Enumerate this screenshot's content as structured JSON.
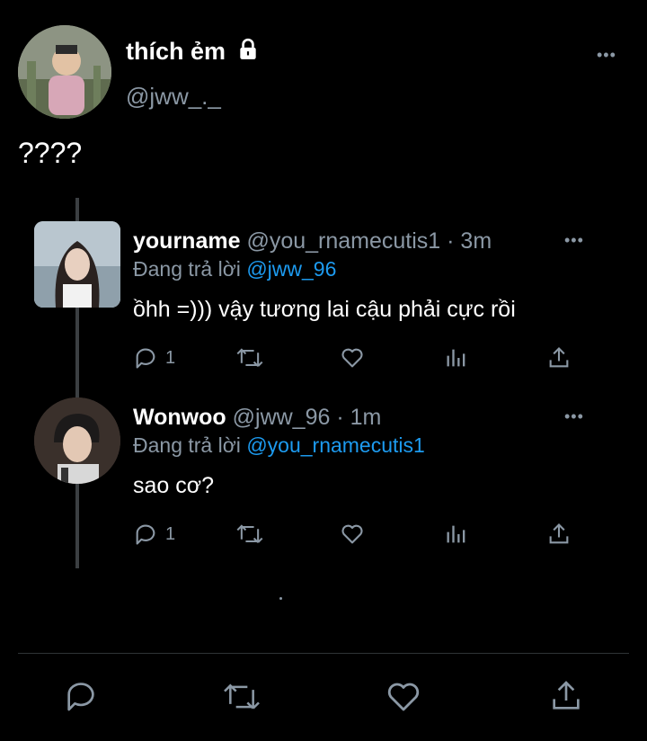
{
  "main_tweet": {
    "display_name": "thích ẻm",
    "handle": "@jww_._",
    "text": "????",
    "avatar_icon": "child-photo-avatar",
    "lock_icon": "lock-icon"
  },
  "replies": [
    {
      "display_name": "yourname",
      "handle": "@you_rnamecutis1",
      "time": "· 3m",
      "replying_prefix": "Đang trả lời",
      "replying_to": "@jww_96",
      "text": "ồhh =))) vậy tương lai cậu phải cực rồi",
      "reply_count": "1"
    },
    {
      "display_name": "Wonwoo",
      "handle": "@jww_96",
      "time": "· 1m",
      "replying_prefix": "Đang trả lời",
      "replying_to": "@you_rnamecutis1",
      "text": "sao cơ?",
      "reply_count": "1"
    }
  ],
  "more_label": "•••",
  "colors": {
    "background": "#000000",
    "text": "#e7e9ea",
    "muted": "#8b98a5",
    "link": "#1d9bf0"
  }
}
